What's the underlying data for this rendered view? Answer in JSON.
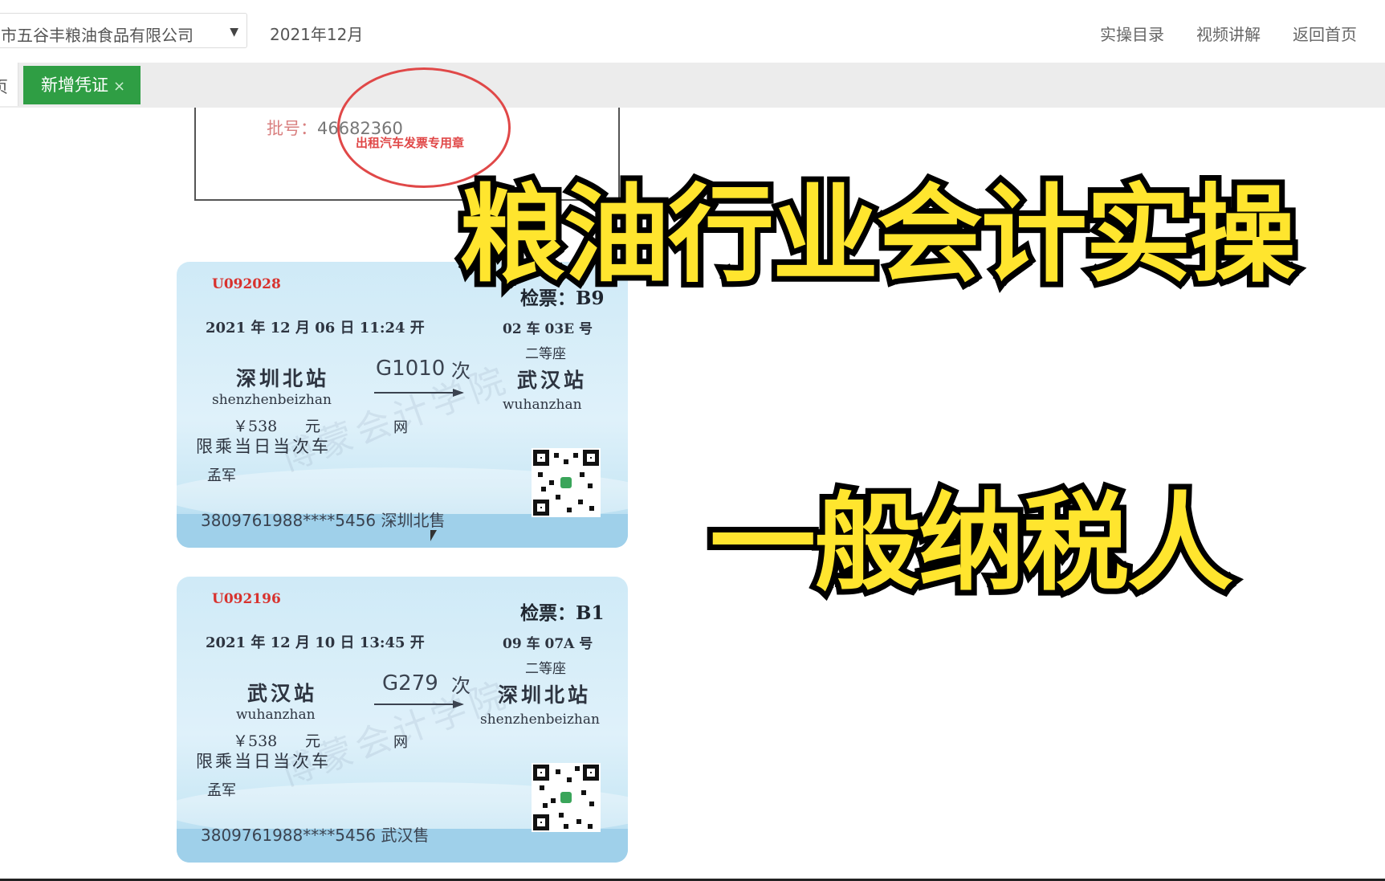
{
  "header": {
    "company": "市五谷丰粮油食品有限公司",
    "period": "2021年12月",
    "nav": [
      "实操目录",
      "视频讲解",
      "返回首页"
    ]
  },
  "tabs": {
    "prev_label": "页",
    "active_label": "新增凭证",
    "close_symbol": "×"
  },
  "taxi_invoice": {
    "batch_label": "批号：",
    "batch_no": "46682360",
    "stamp_text": "出租汽车发票专用章"
  },
  "tickets": [
    {
      "serial": "U092028",
      "gate": "检票：B9",
      "datetime": "2021 年 12 月 06 日 11:24 开",
      "seat": "02 车 03E 号",
      "class": "二等座",
      "from_station": "深圳北站",
      "from_pinyin": "shenzhenbeizhan",
      "train_no": "G1010",
      "train_suffix": "次",
      "to_station": "武汉站",
      "to_pinyin": "wuhanzhan",
      "price": "￥538",
      "price_unit": "元",
      "channel": "网",
      "limit": "限乘当日当次车",
      "passenger": "孟军",
      "id_line": "3809761988****5456 深圳北售"
    },
    {
      "serial": "U092196",
      "gate": "检票：B1",
      "datetime": "2021 年 12 月 10 日 13:45 开",
      "seat": "09 车 07A 号",
      "class": "二等座",
      "from_station": "武汉站",
      "from_pinyin": "wuhanzhan",
      "train_no": "G279",
      "train_suffix": "次",
      "to_station": "深圳北站",
      "to_pinyin": "shenzhenbeizhan",
      "price": "￥538",
      "price_unit": "元",
      "channel": "网",
      "limit": "限乘当日当次车",
      "passenger": "孟军",
      "id_line": "3809761988****5456 武汉售"
    }
  ],
  "watermark": "博蒙会计学院",
  "overlay": {
    "title_line1": "粮油行业会计实操",
    "title_line2": "一般纳税人"
  },
  "colors": {
    "accent_green": "#2f9e44",
    "title_yellow": "#ffe52e",
    "serial_red": "#d8322e",
    "ticket_blue": "#cfeaf7"
  }
}
